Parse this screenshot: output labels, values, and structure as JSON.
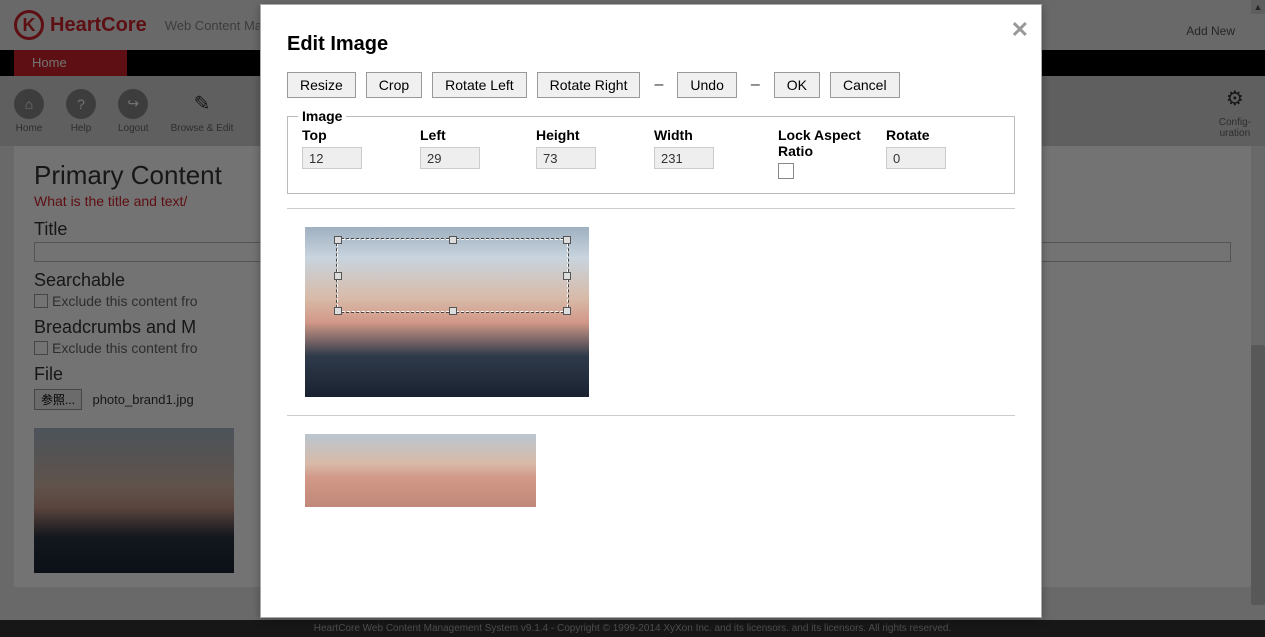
{
  "header": {
    "brand": "HeartCore",
    "subtitle": "Web Content Mana",
    "add_new": "Add New"
  },
  "nav": {
    "home": "Home"
  },
  "toolbar": {
    "home": "Home",
    "help": "Help",
    "logout": "Logout",
    "browse_edit": "Browse & Edit",
    "configuration": "Config-\nuration"
  },
  "content": {
    "primary_heading": "Primary Content",
    "primary_sub": "What is the title and text/",
    "title_label": "Title",
    "searchable_label": "Searchable",
    "exclude_search": "Exclude this content fro",
    "breadcrumbs_label": "Breadcrumbs and M",
    "exclude_breadcrumbs": "Exclude this content fro",
    "file_label": "File",
    "browse_btn": "参照...",
    "filename": "photo_brand1.jpg"
  },
  "footer": "HeartCore Web Content Management System v9.1.4 - Copyright © 1999-2014 XyXon Inc. and its licensors. and its licensors. All rights reserved.",
  "modal": {
    "title": "Edit Image",
    "buttons": {
      "resize": "Resize",
      "crop": "Crop",
      "rotate_left": "Rotate Left",
      "rotate_right": "Rotate Right",
      "undo": "Undo",
      "ok": "OK",
      "cancel": "Cancel"
    },
    "fieldset_legend": "Image",
    "fields": {
      "top_label": "Top",
      "top_value": "12",
      "left_label": "Left",
      "left_value": "29",
      "height_label": "Height",
      "height_value": "73",
      "width_label": "Width",
      "width_value": "231",
      "lock_label": "Lock Aspect Ratio",
      "rotate_label": "Rotate",
      "rotate_value": "0"
    }
  }
}
